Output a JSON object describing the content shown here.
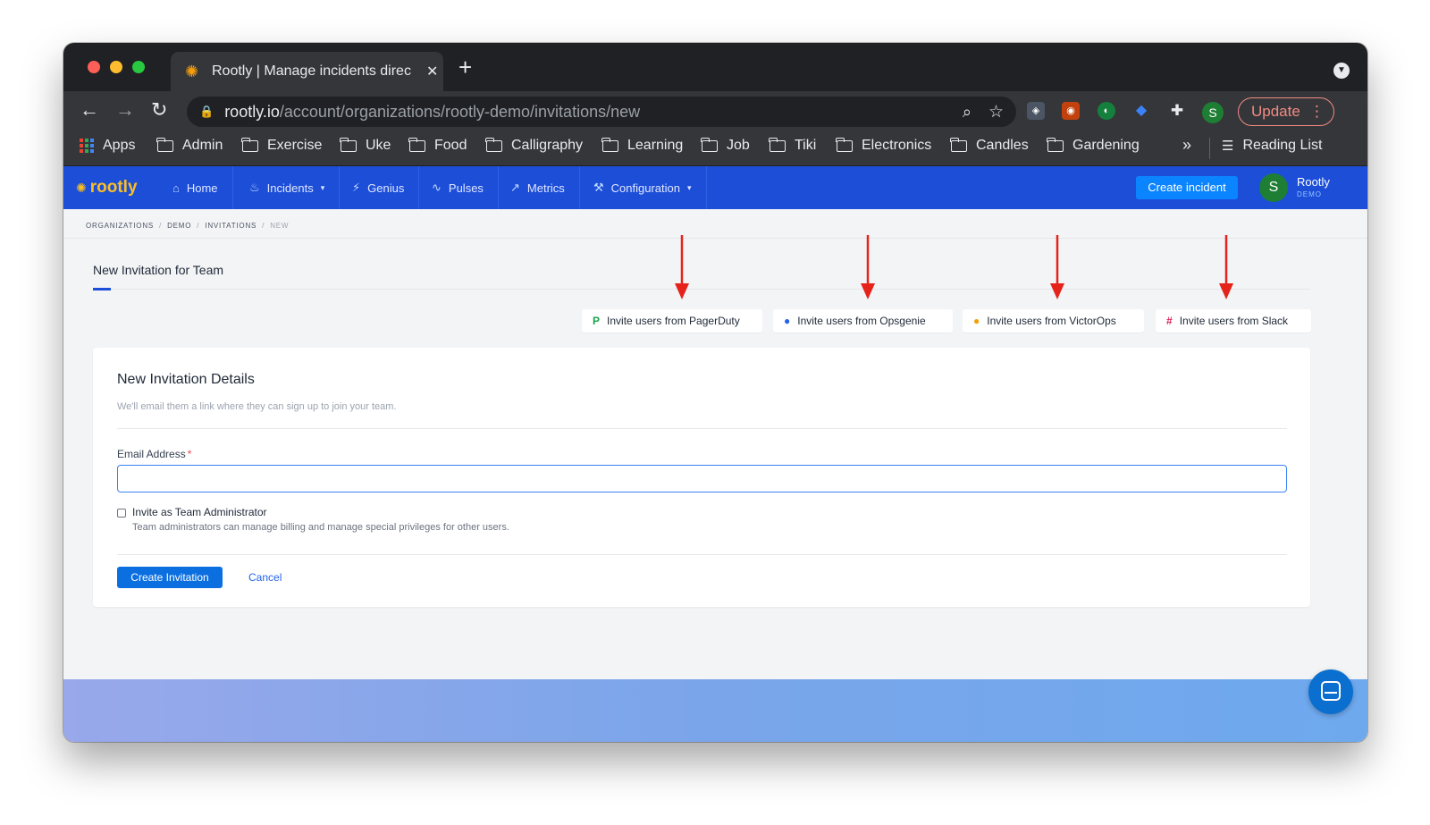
{
  "browser": {
    "tab_title": "Rootly | Manage incidents direc",
    "tab_close_icon": "close-icon",
    "url_host": "rootly.io",
    "url_path": "/account/organizations/rootly-demo/invitations/new",
    "profile_initial": "S",
    "update_label": "Update",
    "bookmarks": [
      "Apps",
      "Admin",
      "Exercise",
      "Uke",
      "Food",
      "Calligraphy",
      "Learning",
      "Job",
      "Tiki",
      "Electronics",
      "Candles",
      "Gardening"
    ],
    "more_bookmarks": "»",
    "reading_list": "Reading List"
  },
  "app": {
    "logo": "rootly",
    "nav": [
      {
        "label": "Home",
        "icon": "home-icon"
      },
      {
        "label": "Incidents",
        "icon": "flame-icon"
      },
      {
        "label": "Genius",
        "icon": "bolt-icon"
      },
      {
        "label": "Pulses",
        "icon": "pulse-icon"
      },
      {
        "label": "Metrics",
        "icon": "chart-icon"
      },
      {
        "label": "Configuration",
        "icon": "wrench-icon"
      }
    ],
    "create_incident": "Create incident",
    "user_initial": "S",
    "user_name": "Rootly",
    "user_org": "DEMO"
  },
  "breadcrumb": [
    "ORGANIZATIONS",
    "DEMO",
    "INVITATIONS",
    "NEW"
  ],
  "page_title": "New Invitation for Team",
  "import_buttons": [
    {
      "label": "Invite users from PagerDuty",
      "icon": "pagerduty-icon",
      "color": "#16a34a"
    },
    {
      "label": "Invite users from Opsgenie",
      "icon": "opsgenie-icon",
      "color": "#2563eb"
    },
    {
      "label": "Invite users from VictorOps",
      "icon": "victorops-icon",
      "color": "#f59e0b"
    },
    {
      "label": "Invite users from Slack",
      "icon": "slack-icon",
      "color": "#e01e5a"
    }
  ],
  "form": {
    "card_title": "New Invitation Details",
    "card_subtitle": "We'll email them a link where they can sign up to join your team.",
    "email_label": "Email Address",
    "required_mark": "*",
    "email_value": "",
    "admin_label": "Invite as Team Administrator",
    "admin_help": "Team administrators can manage billing and manage special privileges for other users.",
    "submit_label": "Create Invitation",
    "cancel_label": "Cancel"
  },
  "colors": {
    "nav_bg": "#1d4ed8",
    "primary_button": "#0b84ff",
    "annotation_arrow": "#e5231b"
  }
}
